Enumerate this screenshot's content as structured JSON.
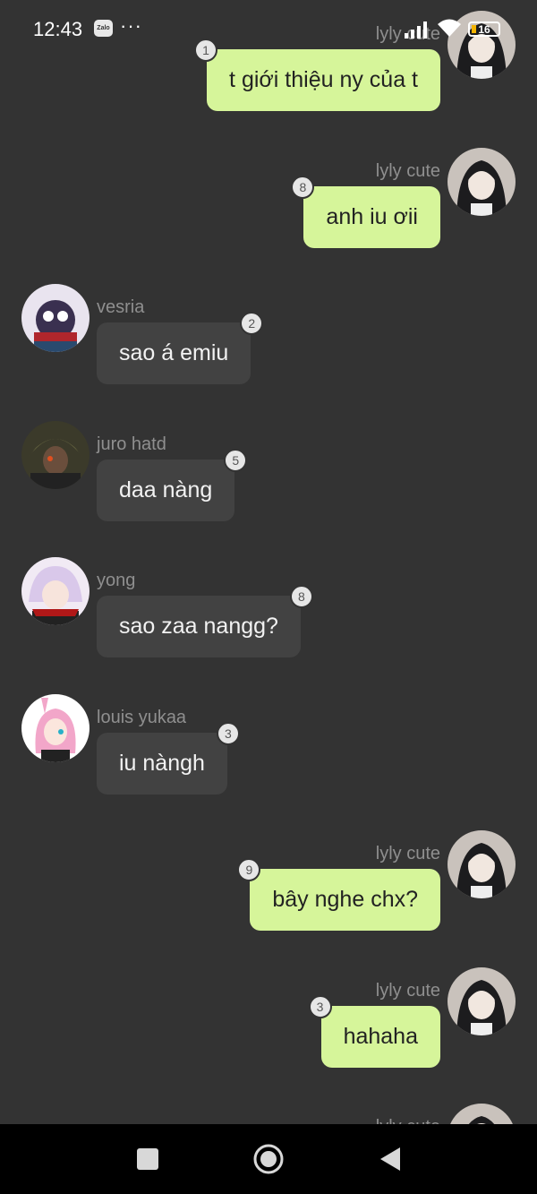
{
  "status_bar": {
    "time": "12:43",
    "app_icon": "zalo-icon",
    "app_icon_text": "Zalo",
    "more": "···",
    "battery": "16"
  },
  "messages": [
    {
      "side": "right",
      "sender": "lyly cute",
      "text": "t giới thiệu ny của t",
      "count": "1"
    },
    {
      "side": "right",
      "sender": "lyly cute",
      "text": "anh iu ơii",
      "count": "8"
    },
    {
      "side": "left",
      "sender": "vesria",
      "text": "sao á emiu",
      "count": "2"
    },
    {
      "side": "left",
      "sender": "juro hatd",
      "text": "daa nàng",
      "count": "5"
    },
    {
      "side": "left",
      "sender": "yong",
      "text": "sao zaa nangg?",
      "count": "8"
    },
    {
      "side": "left",
      "sender": "louis yukaa",
      "text": "iu nàngh",
      "count": "3"
    },
    {
      "side": "right",
      "sender": "lyly cute",
      "text": "bây nghe chx?",
      "count": "9"
    },
    {
      "side": "right",
      "sender": "lyly cute",
      "text": "hahaha",
      "count": "3"
    },
    {
      "side": "right",
      "sender": "lyly cute",
      "text": "",
      "count": ""
    }
  ],
  "nav": {
    "recent": "recent-apps-icon",
    "home": "home-icon",
    "back": "back-icon"
  },
  "colors": {
    "background": "#333333",
    "outgoing_bubble": "#d6f59a",
    "incoming_bubble": "#424242"
  }
}
